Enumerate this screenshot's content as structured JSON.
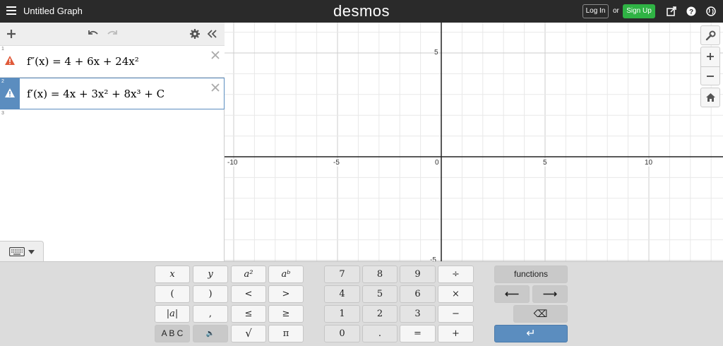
{
  "header": {
    "title": "Untitled Graph",
    "logo": "desmos",
    "login_label": "Log In",
    "or_label": "or",
    "signup_label": "Sign Up"
  },
  "expressions": [
    {
      "index": "1",
      "math": "f″(x) = 4 + 6x + 24x²",
      "status": "error",
      "status_color": "#e05a3a"
    },
    {
      "index": "2",
      "math": "f′(x) = 4x + 3x² + 8x³ + C",
      "status": "warning",
      "status_color": "#ffffff"
    }
  ],
  "empty_row_index": "3",
  "graph": {
    "x_ticks": [
      "-10",
      "-5",
      "0",
      "5",
      "10"
    ],
    "y_ticks": [
      "5",
      "-5"
    ],
    "axis_color": "#222222",
    "grid_color": "#e8e8e8",
    "major_grid_color": "#cccccc"
  },
  "keypad": {
    "row1": [
      "x",
      "y",
      "a²",
      "aᵇ"
    ],
    "row2": [
      "(",
      ")",
      "<",
      ">"
    ],
    "row3": [
      "|a|",
      ",",
      "≤",
      "≥"
    ],
    "row4": [
      "A B C",
      "🔈",
      "√",
      "π"
    ],
    "num_row1": [
      "7",
      "8",
      "9",
      "÷"
    ],
    "num_row2": [
      "4",
      "5",
      "6",
      "×"
    ],
    "num_row3": [
      "1",
      "2",
      "3",
      "−"
    ],
    "num_row4": [
      "0",
      ".",
      "=",
      "+"
    ],
    "functions_label": "functions",
    "left_arrow": "⟵",
    "right_arrow": "⟶",
    "backspace": "⌫",
    "enter": "↵"
  },
  "colors": {
    "accent": "#5b8dbf",
    "signup": "#2fb344",
    "topbar": "#2a2a2a"
  }
}
